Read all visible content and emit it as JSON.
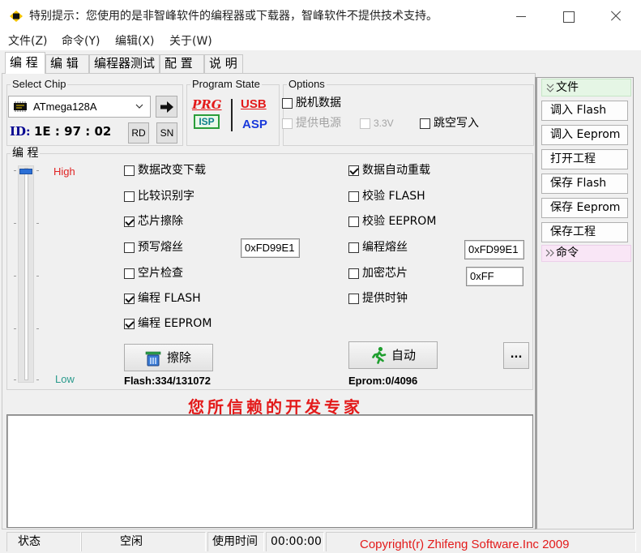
{
  "window": {
    "title": "特别提示：您使用的是非智峰软件的编程器或下载器，智峰软件不提供技术支持。",
    "icons": {
      "app": "chip-icon",
      "minimize": "minimize-icon",
      "maximize": "maximize-icon",
      "close": "close-icon"
    }
  },
  "menu": [
    "文件(Z)",
    "命令(Y)",
    "编辑(X)",
    "关于(W)"
  ],
  "tabs": {
    "items": [
      "编 程",
      "编 辑",
      "编程器测试",
      "配 置",
      "说 明"
    ],
    "active": 0
  },
  "select_chip": {
    "label": "Select Chip",
    "chip": "ATmega128A",
    "id_label": "ID:",
    "id_value": "1E : 97 : 02",
    "rd_label": "RD",
    "sn_label": "SN"
  },
  "program_state": {
    "label": "Program State",
    "prg": "PRG",
    "isp": "ISP",
    "usb": "USB",
    "asp": "ASP"
  },
  "options": {
    "label": "Options",
    "offline": {
      "label": "脱机数据",
      "checked": false,
      "enabled": true
    },
    "power": {
      "label": "提供电源",
      "checked": false,
      "enabled": false
    },
    "v33": {
      "label": "3.3V",
      "checked": false,
      "enabled": false
    },
    "skip_blank": {
      "label": "跳空写入",
      "checked": false,
      "enabled": true
    }
  },
  "program": {
    "label": "编 程",
    "speed": {
      "high_label": "High",
      "low_label": "Low",
      "level": 1.0
    },
    "left": [
      {
        "label": "数据改变下载",
        "checked": false
      },
      {
        "label": "比较识别字",
        "checked": false
      },
      {
        "label": "芯片擦除",
        "checked": true
      },
      {
        "label": "预写熔丝",
        "checked": false
      },
      {
        "label": "空片检查",
        "checked": false
      },
      {
        "label": "编程 FLASH",
        "checked": true
      },
      {
        "label": "编程 EEPROM",
        "checked": true
      }
    ],
    "right": [
      {
        "label": "数据自动重载",
        "checked": true
      },
      {
        "label": "校验 FLASH",
        "checked": false
      },
      {
        "label": "校验 EEPROM",
        "checked": false
      },
      {
        "label": "编程熔丝",
        "checked": false
      },
      {
        "label": "加密芯片",
        "checked": false
      },
      {
        "label": "提供时钟",
        "checked": false
      }
    ],
    "prewrite_fuse_value": "0xFD99E1",
    "fuse_value": "0xFD99E1",
    "lock_value": "0xFF",
    "erase_label": "擦除",
    "auto_label": "自动",
    "more_label": "...",
    "flash_counter": "Flash:334/131072",
    "eprom_counter": "Eprom:0/4096"
  },
  "slogan": "您所信赖的开发专家",
  "right_panel": {
    "file_header": "文件",
    "file_buttons": [
      "调入 Flash",
      "调入 Eeprom",
      "打开工程",
      "保存 Flash",
      "保存 Eeprom",
      "保存工程"
    ],
    "command_header": "命令"
  },
  "status_bar": {
    "state_label": "状态",
    "state_value": "空闲",
    "time_label": "使用时间",
    "time_value": "00:00:00",
    "copyright": "Copyright(r) Zhifeng Software.Inc 2009"
  },
  "colors": {
    "brand_red": "#e31a1a",
    "high": "#e02424",
    "low": "#2a9a8c",
    "file_header": "#e5f6e5",
    "command_header": "#f9e6f6",
    "slider_thumb": "#2b6fd6",
    "id_blue": "#000090"
  }
}
